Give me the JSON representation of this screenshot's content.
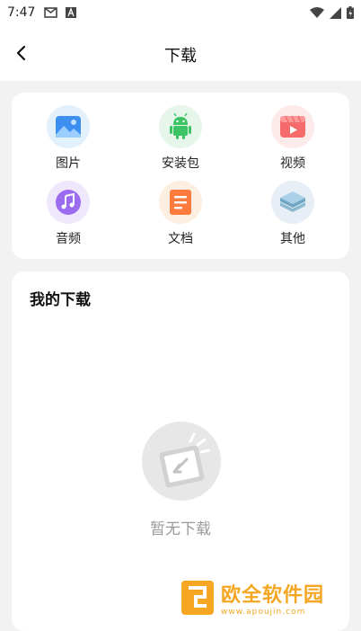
{
  "status_bar": {
    "time": "7:47"
  },
  "header": {
    "title": "下载"
  },
  "categories": [
    {
      "label": "图片",
      "icon": "image-icon",
      "bg": "#e3f1fd"
    },
    {
      "label": "安装包",
      "icon": "android-icon",
      "bg": "#e6f6ea"
    },
    {
      "label": "视频",
      "icon": "video-icon",
      "bg": "#fdeaea"
    },
    {
      "label": "音频",
      "icon": "music-icon",
      "bg": "#efe7fb"
    },
    {
      "label": "文档",
      "icon": "document-icon",
      "bg": "#fdeee2"
    },
    {
      "label": "其他",
      "icon": "layers-icon",
      "bg": "#e8eef5"
    }
  ],
  "downloads": {
    "title": "我的下载",
    "empty_text": "暂无下载"
  },
  "watermark": {
    "text": "欧全软件园",
    "url": "www.apoujin.com"
  }
}
